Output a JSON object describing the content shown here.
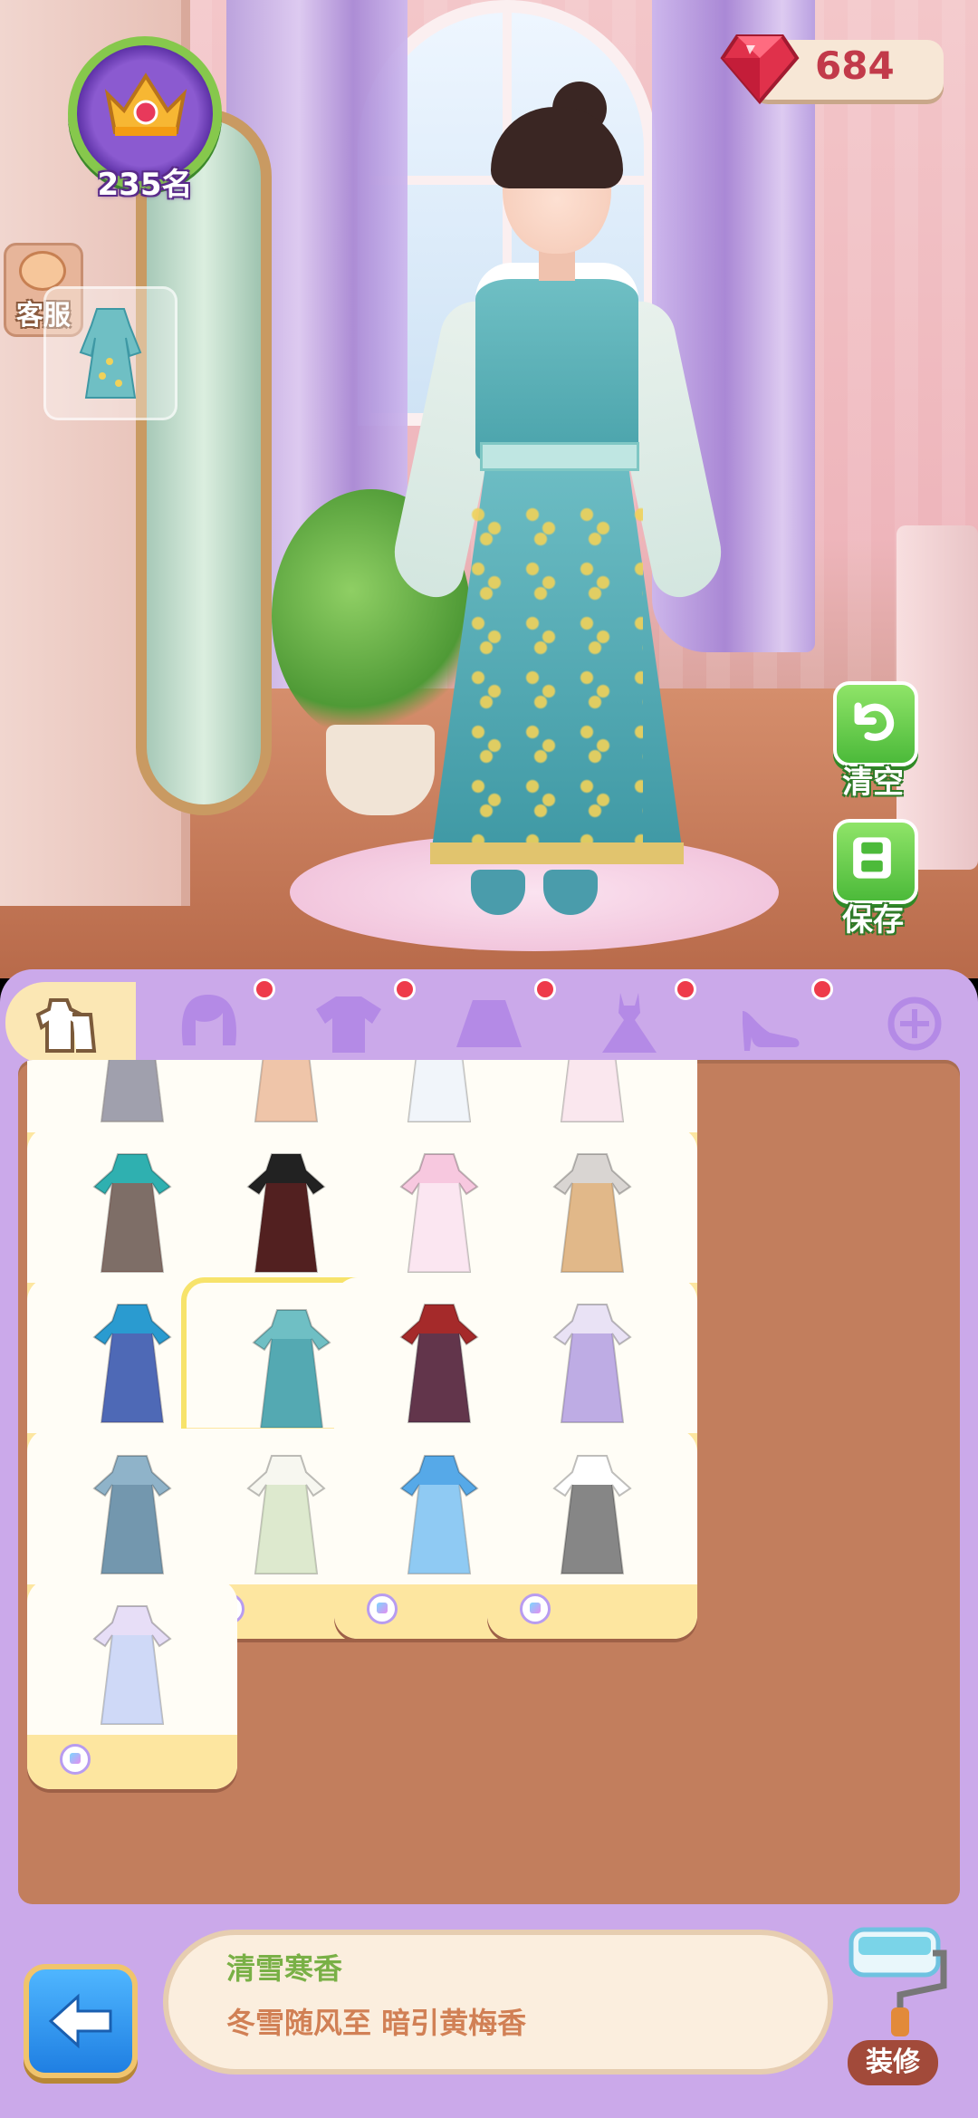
{
  "hud": {
    "rank_label": "235名",
    "gem_count": "684",
    "service_label": "客服"
  },
  "side_buttons": {
    "clear_label": "清空",
    "save_label": "保存"
  },
  "tabs": [
    {
      "name": "full-outfit",
      "active": true,
      "badge": false
    },
    {
      "name": "hair",
      "active": false,
      "badge": true
    },
    {
      "name": "top",
      "active": false,
      "badge": true
    },
    {
      "name": "skirt",
      "active": false,
      "badge": true
    },
    {
      "name": "dress",
      "active": false,
      "badge": true
    },
    {
      "name": "shoes",
      "active": false,
      "badge": true
    },
    {
      "name": "accessory",
      "active": false,
      "badge": false
    }
  ],
  "item_grid": {
    "rows_visible": 5,
    "selected_index": 9,
    "items": [
      {
        "icon": "outfit-partial-1"
      },
      {
        "icon": "outfit-partial-2"
      },
      {
        "icon": "outfit-partial-3"
      },
      {
        "icon": "outfit-partial-4"
      },
      {
        "icon": "teal-gold-outfit"
      },
      {
        "icon": "black-robe-outfit"
      },
      {
        "icon": "pink-white-romper"
      },
      {
        "icon": "grey-dress"
      },
      {
        "icon": "blue-hanfu"
      },
      {
        "icon": "plum-blossom-dress"
      },
      {
        "icon": "red-ethnic-outfit"
      },
      {
        "icon": "lavender-dress"
      },
      {
        "icon": "silver-armor-outfit"
      },
      {
        "icon": "white-floral-dress"
      },
      {
        "icon": "blue-ball-gown"
      },
      {
        "icon": "polka-dot-dress"
      },
      {
        "icon": "fairy-dress"
      }
    ]
  },
  "info": {
    "title": "清雪寒香",
    "description": "冬雪随风至 暗引黄梅香"
  },
  "bottom": {
    "decorate_label": "装修"
  },
  "colors": {
    "panel": "#cba9ea",
    "grid_bg": "#c27e5d",
    "accent_green": "#4cba3a",
    "gem_red": "#c23a4a",
    "title_green": "#79b046",
    "desc_orange": "#d18055"
  }
}
